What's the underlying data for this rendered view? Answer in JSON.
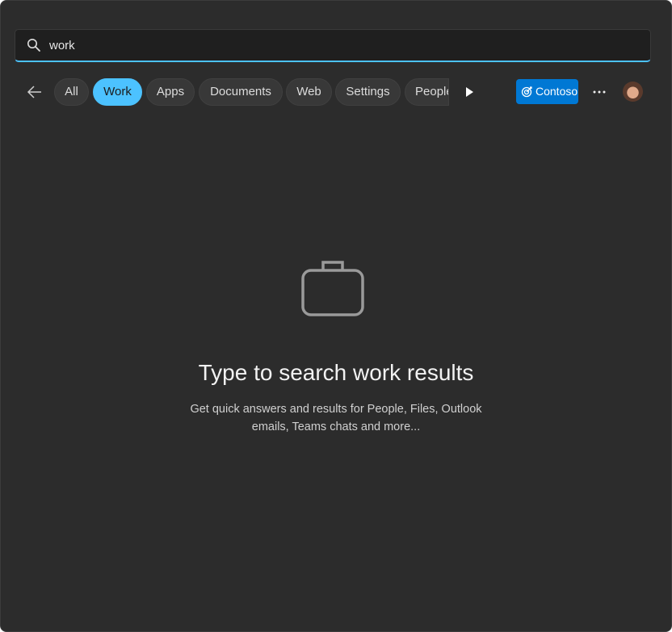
{
  "search": {
    "value": "work",
    "icon": "search-icon"
  },
  "filters": {
    "back_icon": "arrow-left-icon",
    "chips": [
      {
        "label": "All",
        "active": false
      },
      {
        "label": "Work",
        "active": true
      },
      {
        "label": "Apps",
        "active": false
      },
      {
        "label": "Documents",
        "active": false
      },
      {
        "label": "Web",
        "active": false
      },
      {
        "label": "Settings",
        "active": false
      },
      {
        "label": "People",
        "active": false
      }
    ],
    "scroll_icon": "play-right-icon"
  },
  "org_button": {
    "label": "Contoso",
    "icon": "target-icon",
    "color": "#0078d4"
  },
  "more_icon": "more-horizontal-icon",
  "empty_state": {
    "icon": "briefcase-icon",
    "title": "Type to search work results",
    "subtitle_line1": "Get quick answers and results for People, Files, Outlook",
    "subtitle_line2": "emails, Teams chats and more..."
  },
  "accent_color": "#4cc2ff"
}
